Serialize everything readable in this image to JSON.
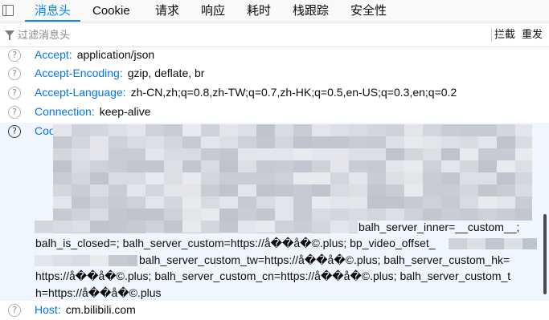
{
  "tabs": [
    "消息头",
    "Cookie",
    "请求",
    "响应",
    "耗时",
    "栈跟踪",
    "安全性"
  ],
  "filter": {
    "placeholder": "过滤消息头",
    "block_label": "拦截",
    "resend_label": "重发"
  },
  "headers": [
    {
      "name": "Accept:",
      "value": "application/json"
    },
    {
      "name": "Accept-Encoding:",
      "value": "gzip, deflate, br"
    },
    {
      "name": "Accept-Language:",
      "value": "zh-CN,zh;q=0.8,zh-TW;q=0.7,zh-HK;q=0.5,en-US;q=0.3,en;q=0.2"
    },
    {
      "name": "Connection:",
      "value": "keep-alive"
    }
  ],
  "cookie": {
    "name": "Cookie:",
    "lines": [
      "balh_server_inner=__custom__;",
      "balh_is_closed=; balh_server_custom=https://å��å�©.plus; bp_video_offset_",
      "balh_server_custom_tw=https://å��å�©.plus; balh_server_custom_hk=",
      "https://å��å�©.plus; balh_server_custom_cn=https://å��å�©.plus; balh_server_custom_t",
      "h=https://å��å�©.plus"
    ]
  },
  "host": {
    "name": "Host:",
    "value": "cm.bilibili.com"
  },
  "icons": {
    "help": "help-icon",
    "filter": "filter-funnel-icon",
    "dock": "panel-toggle-icon"
  },
  "colors": {
    "accent": "#0a84ff",
    "header_name": "#0074e8",
    "selected_bg": "#f0f6ff"
  }
}
